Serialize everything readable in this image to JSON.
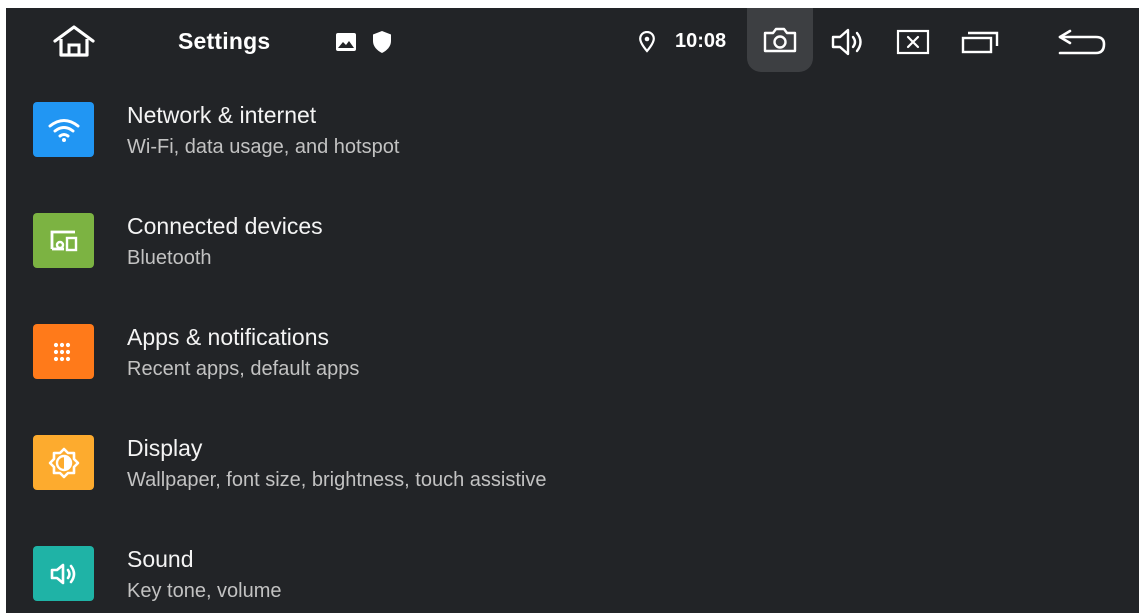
{
  "statusbar": {
    "app_title": "Settings",
    "time": "10:08",
    "icons": {
      "home": "home-icon",
      "notification_image": "image-icon",
      "notification_shield": "shield-icon",
      "location": "location-icon",
      "screenshot": "camera-icon",
      "volume": "volume-icon",
      "close": "close-icon",
      "recents": "recents-icon",
      "back": "back-icon"
    }
  },
  "settings": {
    "items": [
      {
        "title": "Network & internet",
        "subtitle": "Wi-Fi, data usage, and hotspot",
        "icon": "wifi-icon",
        "color": "#2196f3"
      },
      {
        "title": "Connected devices",
        "subtitle": "Bluetooth",
        "icon": "devices-icon",
        "color": "#7cb342"
      },
      {
        "title": "Apps & notifications",
        "subtitle": "Recent apps, default apps",
        "icon": "apps-icon",
        "color": "#ff7a1a"
      },
      {
        "title": "Display",
        "subtitle": "Wallpaper, font size, brightness, touch assistive",
        "icon": "brightness-icon",
        "color": "#fdab2e"
      },
      {
        "title": "Sound",
        "subtitle": "Key tone, volume",
        "icon": "volume-icon",
        "color": "#1fb3a6"
      }
    ]
  },
  "theme": {
    "background": "#222427",
    "text": "#f4f4f4",
    "subtext": "#c2c2c2"
  }
}
